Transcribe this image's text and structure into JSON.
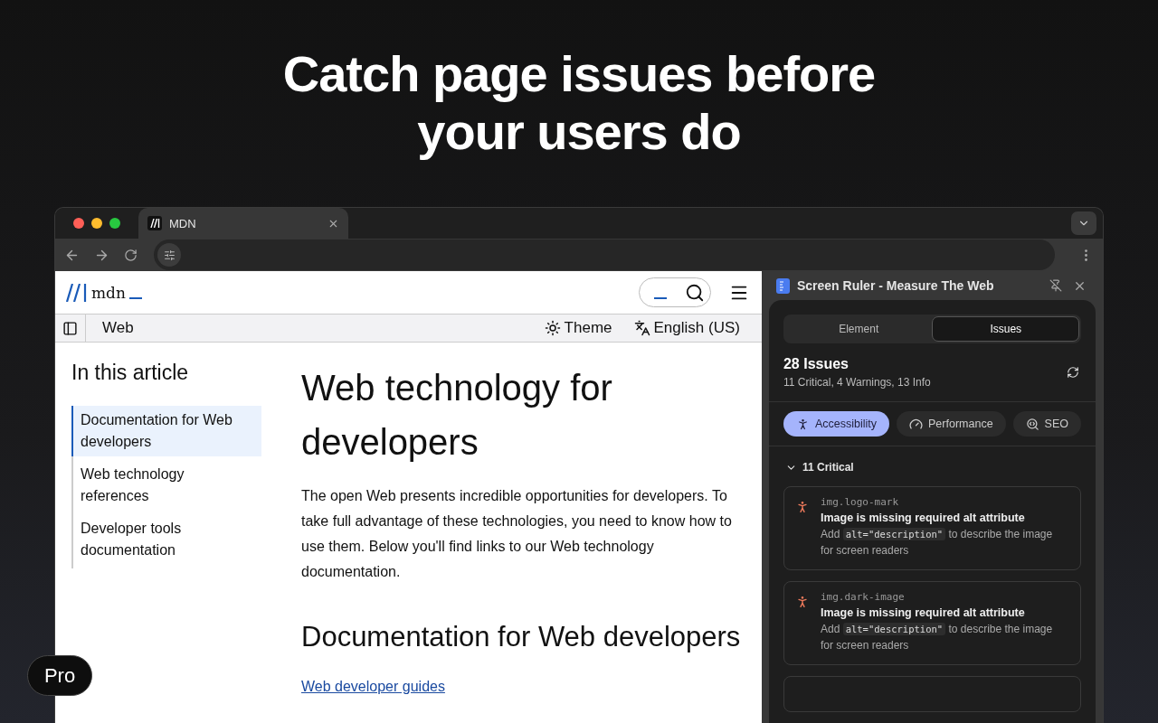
{
  "headline": "Catch page issues before your users do",
  "browser": {
    "tabs": [
      {
        "title": "MDN",
        "selected": true
      }
    ]
  },
  "page": {
    "logo": "mdn",
    "nav": {
      "section": "Web",
      "theme": "Theme",
      "language": "English (US)"
    },
    "toc": {
      "title": "In this article",
      "items": [
        {
          "label": "Documentation for Web developers",
          "selected": true
        },
        {
          "label": "Web technology references",
          "selected": false
        },
        {
          "label": "Developer tools documentation",
          "selected": false
        }
      ]
    },
    "title": "Web technology for developers",
    "intro": "The open Web presents incredible opportunities for developers. To take full advantage of these technologies, you need to know how to use them. Below you'll find links to our Web technology documentation.",
    "section_title": "Documentation for Web developers",
    "link": "Web developer guides"
  },
  "extension": {
    "title": "Screen Ruler - Measure The Web",
    "tabs": [
      {
        "label": "Element",
        "selected": false
      },
      {
        "label": "Issues",
        "selected": true
      }
    ],
    "count": "28 Issues",
    "summary": "11 Critical, 4 Warnings, 13 Info",
    "categories": [
      {
        "label": "Accessibility",
        "kind": "accessibility",
        "selected": true
      },
      {
        "label": "Performance",
        "kind": "performance",
        "selected": false
      },
      {
        "label": "SEO",
        "kind": "seo",
        "selected": false
      }
    ],
    "group": {
      "label": "11 Critical",
      "expanded": true
    },
    "issues": [
      {
        "selector": "img.logo-mark",
        "message": "Image is missing required alt attribute",
        "hint": [
          {
            "kind": "text",
            "text": "Add"
          },
          {
            "kind": "code",
            "text": "alt=\"description\""
          },
          {
            "kind": "text",
            "text": "to describe the image for screen readers"
          }
        ]
      },
      {
        "selector": "img.dark-image",
        "message": "Image is missing required alt attribute",
        "hint": [
          {
            "kind": "text",
            "text": "Add"
          },
          {
            "kind": "code",
            "text": "alt=\"description\""
          },
          {
            "kind": "text",
            "text": "to describe the image for screen readers"
          }
        ]
      }
    ]
  },
  "badge": "Pro"
}
